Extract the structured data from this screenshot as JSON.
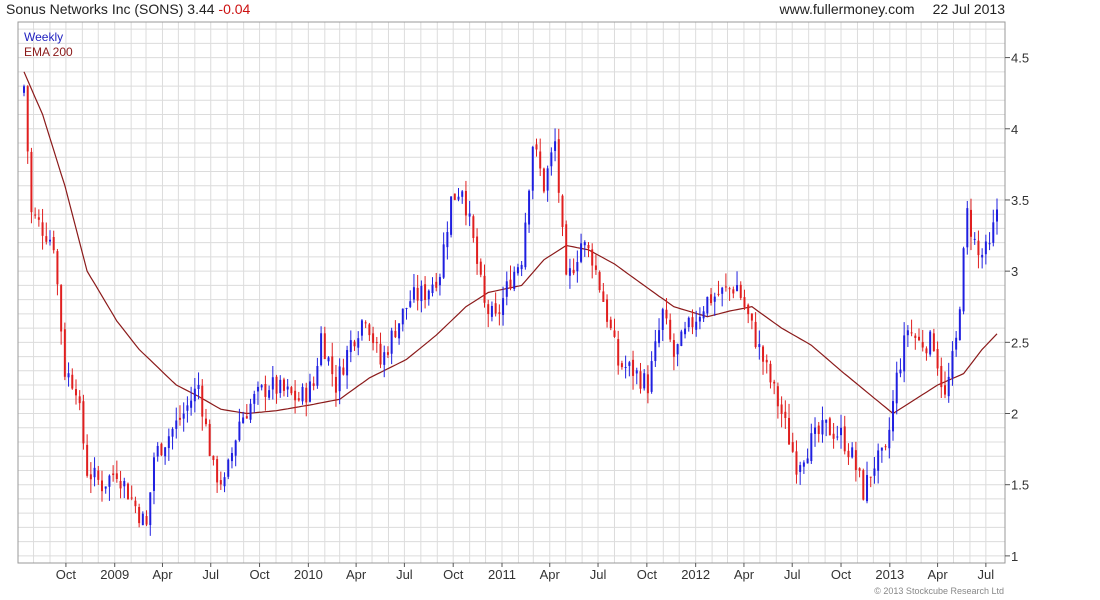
{
  "header": {
    "company": "Sonus Networks Inc (SONS)",
    "price": "3.44",
    "change": "-0.04",
    "source": "www.fullermoney.com",
    "date": "22 Jul 2013"
  },
  "legend": {
    "weekly": "Weekly",
    "ema": "EMA 200"
  },
  "copyright": "© 2013 Stockcube Research Ltd",
  "colors": {
    "up": "#1f1fe0",
    "down": "#e01f1f",
    "ema": "#8b1a1a",
    "grid": "#dcdcdc",
    "weekly_text": "#1f1fbf",
    "ema_text": "#8b1a1a",
    "change_text": "#cc1111"
  },
  "chart_data": {
    "type": "candlestick",
    "title": "Sonus Networks Inc (SONS)",
    "ylim": [
      0.95,
      4.75
    ],
    "y_ticks": [
      1,
      1.5,
      2,
      2.5,
      3,
      3.5,
      4,
      4.5
    ],
    "y_tick_labels": [
      "1",
      "1.5",
      "2",
      "2.5",
      "3",
      "3.5",
      "4",
      "4.5"
    ],
    "x_range": [
      "2008-07-14",
      "2013-07-22"
    ],
    "x_ticks": [
      {
        "date": "2008-10-01",
        "label": "Oct"
      },
      {
        "date": "2009-01-01",
        "label": "2009"
      },
      {
        "date": "2009-04-01",
        "label": "Apr"
      },
      {
        "date": "2009-07-01",
        "label": "Jul"
      },
      {
        "date": "2009-10-01",
        "label": "Oct"
      },
      {
        "date": "2010-01-01",
        "label": "2010"
      },
      {
        "date": "2010-04-01",
        "label": "Apr"
      },
      {
        "date": "2010-07-01",
        "label": "Jul"
      },
      {
        "date": "2010-10-01",
        "label": "Oct"
      },
      {
        "date": "2011-01-01",
        "label": "2011"
      },
      {
        "date": "2011-04-01",
        "label": "Apr"
      },
      {
        "date": "2011-07-01",
        "label": "Jul"
      },
      {
        "date": "2011-10-01",
        "label": "Oct"
      },
      {
        "date": "2012-01-01",
        "label": "2012"
      },
      {
        "date": "2012-04-01",
        "label": "Apr"
      },
      {
        "date": "2012-07-01",
        "label": "Jul"
      },
      {
        "date": "2012-10-01",
        "label": "Oct"
      },
      {
        "date": "2013-01-01",
        "label": "2013"
      },
      {
        "date": "2013-04-01",
        "label": "Apr"
      },
      {
        "date": "2013-07-01",
        "label": "Jul"
      }
    ],
    "close_anchors": [
      [
        "2008-07-14",
        4.3
      ],
      [
        "2008-07-28",
        3.4
      ],
      [
        "2008-08-18",
        3.3
      ],
      [
        "2008-09-08",
        3.2
      ],
      [
        "2008-09-29",
        2.3
      ],
      [
        "2008-10-20",
        2.2
      ],
      [
        "2008-11-10",
        1.6
      ],
      [
        "2008-12-08",
        1.5
      ],
      [
        "2009-01-05",
        1.6
      ],
      [
        "2009-02-02",
        1.4
      ],
      [
        "2009-03-02",
        1.2
      ],
      [
        "2009-03-16",
        1.7
      ],
      [
        "2009-04-13",
        1.85
      ],
      [
        "2009-05-11",
        2.0
      ],
      [
        "2009-06-08",
        2.2
      ],
      [
        "2009-07-06",
        1.6
      ],
      [
        "2009-07-27",
        1.5
      ],
      [
        "2009-08-24",
        1.95
      ],
      [
        "2009-09-21",
        2.1
      ],
      [
        "2009-10-19",
        2.2
      ],
      [
        "2009-11-16",
        2.15
      ],
      [
        "2009-12-14",
        2.1
      ],
      [
        "2010-01-11",
        2.2
      ],
      [
        "2010-01-25",
        2.55
      ],
      [
        "2010-02-22",
        2.2
      ],
      [
        "2010-03-22",
        2.5
      ],
      [
        "2010-04-19",
        2.7
      ],
      [
        "2010-05-17",
        2.35
      ],
      [
        "2010-06-14",
        2.6
      ],
      [
        "2010-07-12",
        2.8
      ],
      [
        "2010-08-09",
        2.85
      ],
      [
        "2010-09-06",
        3.0
      ],
      [
        "2010-09-27",
        3.5
      ],
      [
        "2010-10-18",
        3.6
      ],
      [
        "2010-11-08",
        3.2
      ],
      [
        "2010-11-29",
        2.75
      ],
      [
        "2010-12-20",
        2.65
      ],
      [
        "2011-01-17",
        2.95
      ],
      [
        "2011-02-07",
        3.1
      ],
      [
        "2011-02-28",
        3.9
      ],
      [
        "2011-03-21",
        3.6
      ],
      [
        "2011-04-11",
        3.9
      ],
      [
        "2011-05-02",
        2.9
      ],
      [
        "2011-05-30",
        3.2
      ],
      [
        "2011-06-20",
        3.1
      ],
      [
        "2011-07-11",
        2.8
      ],
      [
        "2011-08-08",
        2.35
      ],
      [
        "2011-09-05",
        2.3
      ],
      [
        "2011-10-03",
        2.2
      ],
      [
        "2011-10-31",
        2.7
      ],
      [
        "2011-11-21",
        2.4
      ],
      [
        "2011-12-19",
        2.6
      ],
      [
        "2012-01-23",
        2.8
      ],
      [
        "2012-02-20",
        2.85
      ],
      [
        "2012-03-19",
        2.9
      ],
      [
        "2012-04-16",
        2.6
      ],
      [
        "2012-05-14",
        2.3
      ],
      [
        "2012-06-11",
        2.0
      ],
      [
        "2012-07-09",
        1.65
      ],
      [
        "2012-08-06",
        1.8
      ],
      [
        "2012-09-03",
        1.9
      ],
      [
        "2012-10-01",
        1.85
      ],
      [
        "2012-10-22",
        1.7
      ],
      [
        "2012-11-12",
        1.45
      ],
      [
        "2012-12-03",
        1.65
      ],
      [
        "2012-12-24",
        1.7
      ],
      [
        "2013-01-14",
        2.25
      ],
      [
        "2013-02-04",
        2.6
      ],
      [
        "2013-02-25",
        2.5
      ],
      [
        "2013-03-25",
        2.5
      ],
      [
        "2013-04-15",
        2.1
      ],
      [
        "2013-05-06",
        2.5
      ],
      [
        "2013-05-27",
        3.4
      ],
      [
        "2013-06-17",
        3.1
      ],
      [
        "2013-07-08",
        3.15
      ],
      [
        "2013-07-22",
        3.44
      ]
    ],
    "ema_anchors": [
      [
        "2008-07-14",
        4.4
      ],
      [
        "2008-08-18",
        4.1
      ],
      [
        "2008-09-29",
        3.6
      ],
      [
        "2008-11-10",
        3.0
      ],
      [
        "2009-01-05",
        2.65
      ],
      [
        "2009-02-16",
        2.45
      ],
      [
        "2009-03-16",
        2.35
      ],
      [
        "2009-04-27",
        2.2
      ],
      [
        "2009-06-08",
        2.12
      ],
      [
        "2009-07-20",
        2.03
      ],
      [
        "2009-09-07",
        2.0
      ],
      [
        "2009-11-02",
        2.02
      ],
      [
        "2010-01-04",
        2.06
      ],
      [
        "2010-03-01",
        2.1
      ],
      [
        "2010-04-26",
        2.25
      ],
      [
        "2010-07-05",
        2.38
      ],
      [
        "2010-08-30",
        2.55
      ],
      [
        "2010-10-25",
        2.75
      ],
      [
        "2010-12-06",
        2.85
      ],
      [
        "2011-02-07",
        2.9
      ],
      [
        "2011-03-21",
        3.08
      ],
      [
        "2011-05-02",
        3.18
      ],
      [
        "2011-06-13",
        3.15
      ],
      [
        "2011-08-01",
        3.05
      ],
      [
        "2011-10-03",
        2.88
      ],
      [
        "2011-11-21",
        2.75
      ],
      [
        "2012-01-23",
        2.68
      ],
      [
        "2012-03-05",
        2.72
      ],
      [
        "2012-04-16",
        2.75
      ],
      [
        "2012-06-11",
        2.6
      ],
      [
        "2012-08-06",
        2.48
      ],
      [
        "2012-10-01",
        2.3
      ],
      [
        "2012-11-19",
        2.15
      ],
      [
        "2013-01-07",
        2.0
      ],
      [
        "2013-02-18",
        2.1
      ],
      [
        "2013-04-01",
        2.2
      ],
      [
        "2013-05-20",
        2.28
      ],
      [
        "2013-06-24",
        2.45
      ],
      [
        "2013-07-22",
        2.56
      ]
    ],
    "grid": true
  }
}
